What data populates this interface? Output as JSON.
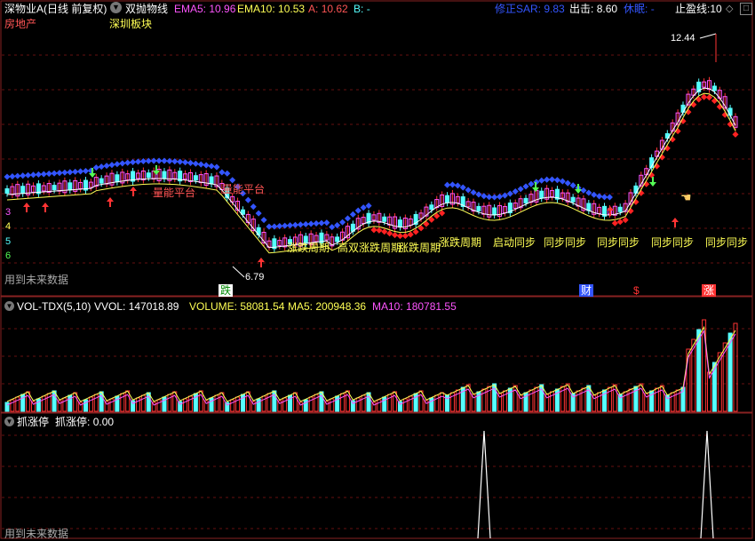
{
  "main_panel": {
    "stock_title": "深物业A(日线 前复权)",
    "formula_name": "双抛物线",
    "ema5": {
      "label": "EMA5:",
      "value": "10.96"
    },
    "ema10": {
      "label": "EMA10:",
      "value": "10.53"
    },
    "a": {
      "label": "A:",
      "value": "10.62"
    },
    "b": {
      "label": "B:",
      "value": "-"
    },
    "sar": {
      "label": "修正SAR:",
      "value": "9.83"
    },
    "exit": {
      "label": "出击:",
      "value": "8.60"
    },
    "rest": {
      "label": "休眠:",
      "value": "-"
    },
    "stop_loss": {
      "label": "止盈线:",
      "value": "10"
    },
    "sector1": "房地产",
    "sector2": "深圳板块",
    "high_label": "12.44",
    "low_label": "6.79",
    "platform_label_1": "量能平台",
    "platform_label_2": "量能平台",
    "side_numbers": [
      "3",
      "4",
      "5",
      "6"
    ],
    "bottom_left_note": "用到未来数据",
    "markers": {
      "die": "跌",
      "cai": "财",
      "dollar": "$",
      "zhang": "涨"
    },
    "yellow_labels": [
      "涨跌周期",
      "高双涨跌周期",
      "涨跌周期",
      "涨跌周期",
      "启动同步",
      "同步同步",
      "同步同步",
      "同步同步",
      "同步同步"
    ]
  },
  "vol_panel": {
    "name": "VOL-TDX(5,10)",
    "vvol": {
      "label": "VVOL:",
      "value": "147018.89"
    },
    "volume": {
      "label": "VOLUME:",
      "value": "58081.54"
    },
    "ma5": {
      "label": "MA5:",
      "value": "200948.36"
    },
    "ma10": {
      "label": "MA10:",
      "value": "180781.55"
    }
  },
  "limit_panel": {
    "name": "抓涨停",
    "value_label": "抓涨停:",
    "value": "0.00",
    "bottom_left_note": "用到未来数据"
  },
  "colors": {
    "up": "#ff5555",
    "down": "#55ffff",
    "magenta": "#ff55ff",
    "yellow": "#ffff55",
    "blue": "#3355ff",
    "green": "#55ff55"
  }
}
